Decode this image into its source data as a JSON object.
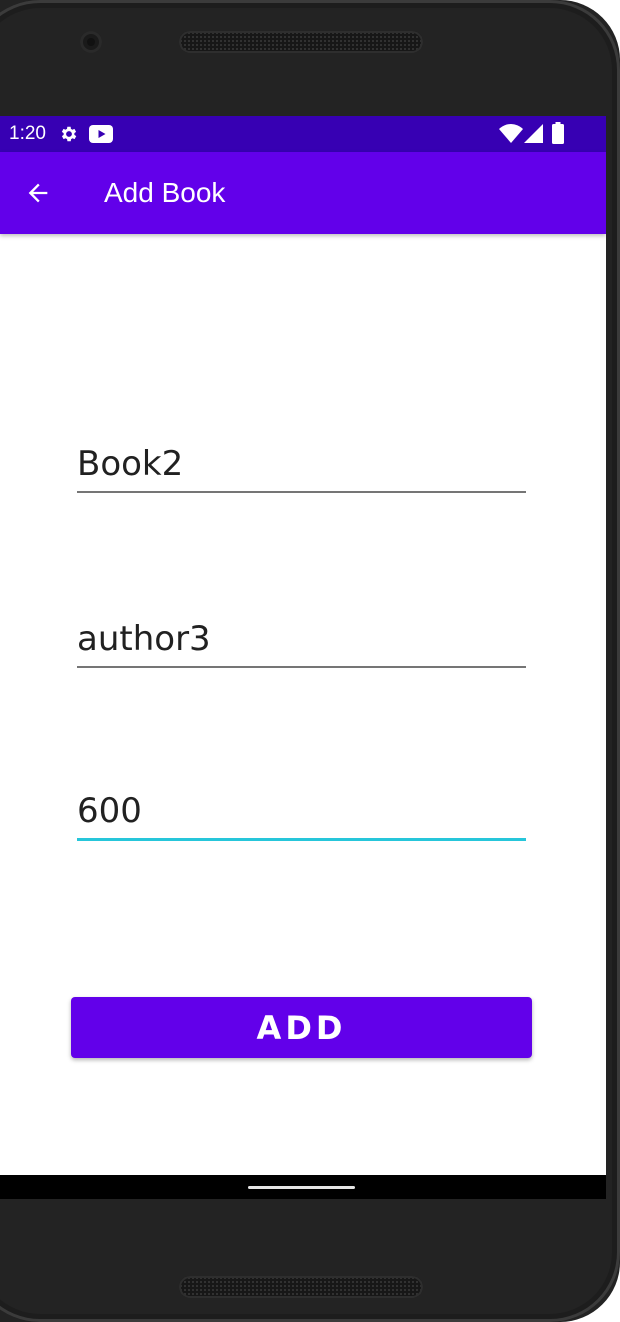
{
  "status_bar": {
    "time": "1:20",
    "background_color": "#3700b3",
    "left_icons": [
      "settings-gear-icon",
      "youtube-icon"
    ],
    "right_icons": [
      "wifi-icon",
      "cellular-signal-icon",
      "battery-icon"
    ]
  },
  "app_bar": {
    "title": "Add Book",
    "background_color": "#6200ea",
    "back_icon": "arrow-back-icon"
  },
  "form": {
    "fields": [
      {
        "name": "book-name-field",
        "value": "Book2",
        "focused": false
      },
      {
        "name": "author-field",
        "value": "author3",
        "focused": false
      },
      {
        "name": "pages-field",
        "value": "600",
        "focused": true
      }
    ],
    "focus_color": "#26c6da",
    "add_button": {
      "label": "ADD",
      "background_color": "#6200ea"
    }
  },
  "navigation": {
    "home_handle_icon": "home-gesture-handle"
  }
}
